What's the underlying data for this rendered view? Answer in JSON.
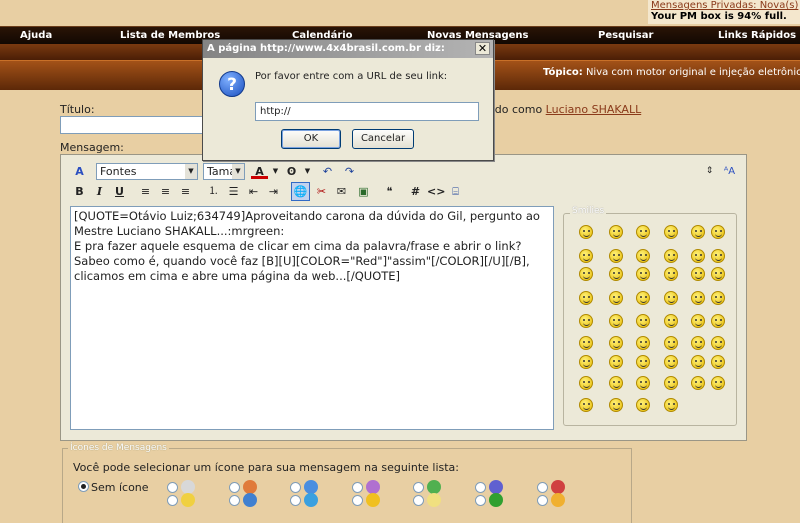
{
  "pm_notice": {
    "link": "Mensagens Privadas: Nova(s)",
    "full": "Your PM box is 94% full."
  },
  "navbar": [
    "Ajuda",
    "Lista de Membros",
    "Calendário",
    "Novas Mensagens",
    "Pesquisar",
    "Links Rápidos"
  ],
  "topic": {
    "label": "Tópico:",
    "title": "Niva com motor original e injeção eletrônica"
  },
  "form": {
    "title_label": "Título:",
    "logged_prefix": "ado como ",
    "logged_user": "Luciano SHAKALL",
    "message_label": "Mensagem:"
  },
  "toolbar": {
    "font_select": "Fontes",
    "size_select": "Taman",
    "bold": "B",
    "italic": "I",
    "underline": "U",
    "hash": "#",
    "code": "<>"
  },
  "message_text_lines": [
    "[QUOTE=Otávio Luiz;634749]Aproveitando carona da dúvida do Gil, pergunto ao",
    "Mestre Luciano SHAKALL...:mrgreen:",
    "E pra fazer aquele esquema de clicar em cima da palavra/frase e abrir o link?",
    "Sabeo como é, quando você faz [B][U][COLOR=\"Red\"]\"assim\"[/COLOR][/U][/B],",
    "clicamos em cima e abre uma página da web...[/QUOTE]"
  ],
  "smilies_legend": "Smilies",
  "icons": {
    "legend": "Ícones de Mensagens",
    "description": "Você pode selecionar um ícone para sua mensagem na seguinte lista:",
    "no_icon_label": "Sem ícone"
  },
  "dialog": {
    "title": "A página http://www.4x4brasil.com.br diz:",
    "close": "✕",
    "qicon": "?",
    "prompt": "Por favor entre com a URL de seu link:",
    "input_value": "http://",
    "ok": "OK",
    "cancel": "Cancelar"
  }
}
